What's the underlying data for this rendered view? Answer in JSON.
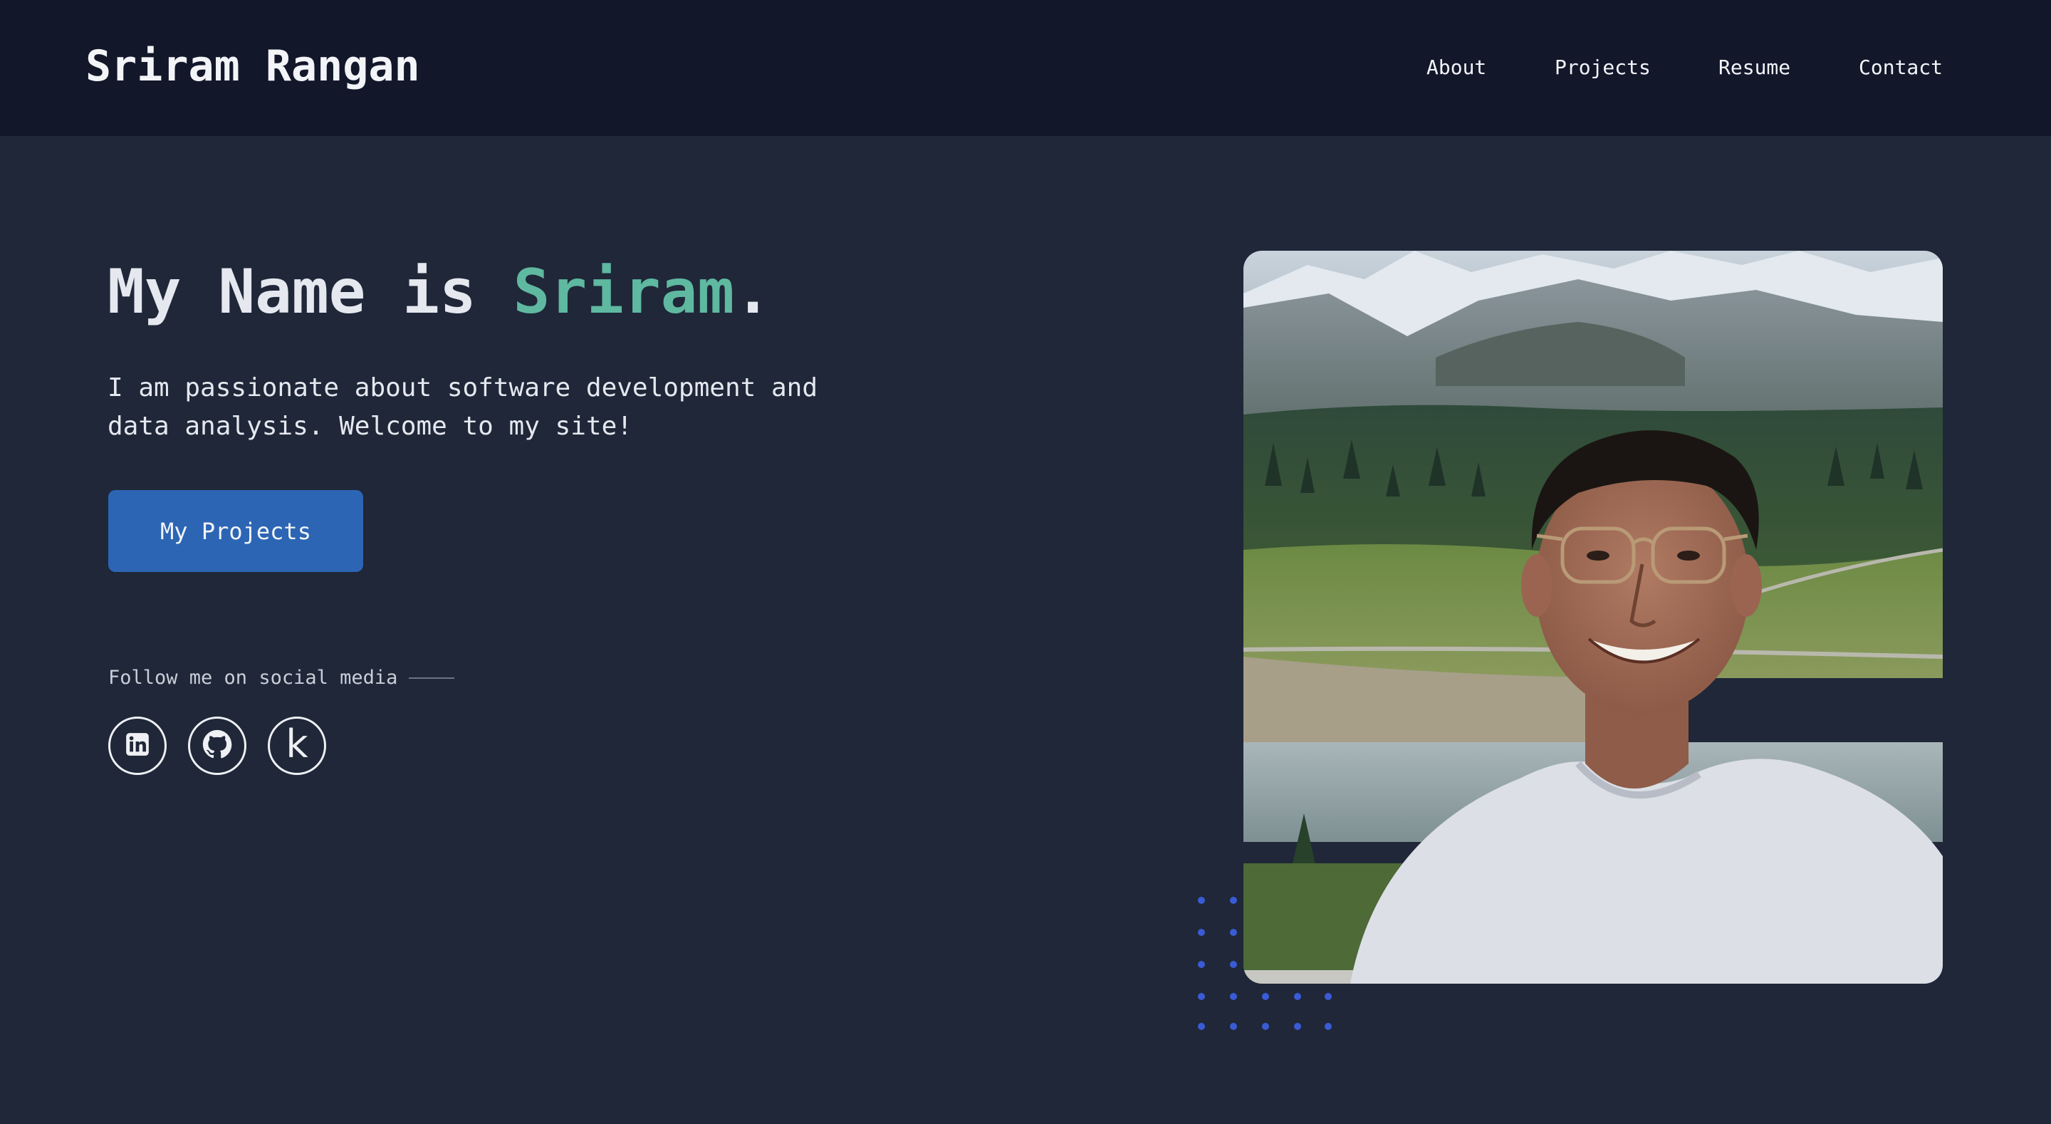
{
  "header": {
    "brand": "Sriram Rangan",
    "nav": [
      "About",
      "Projects",
      "Resume",
      "Contact"
    ]
  },
  "hero": {
    "title_prefix": "My Name is ",
    "title_name": "Sriram",
    "title_suffix": ".",
    "description": "I am passionate about software development and data analysis. Welcome to my site!",
    "cta_label": "My Projects"
  },
  "social": {
    "label": "Follow me on social media",
    "links": [
      {
        "name": "linkedin",
        "icon": "linkedin-icon"
      },
      {
        "name": "github",
        "icon": "github-icon"
      },
      {
        "name": "kaggle",
        "icon": "kaggle-icon",
        "glyph": "k"
      }
    ]
  },
  "colors": {
    "background": "#1f2738",
    "header": "#12172a",
    "accent": "#5fb8a0",
    "button": "#2c65b4",
    "dots": "#3b5bd6"
  }
}
